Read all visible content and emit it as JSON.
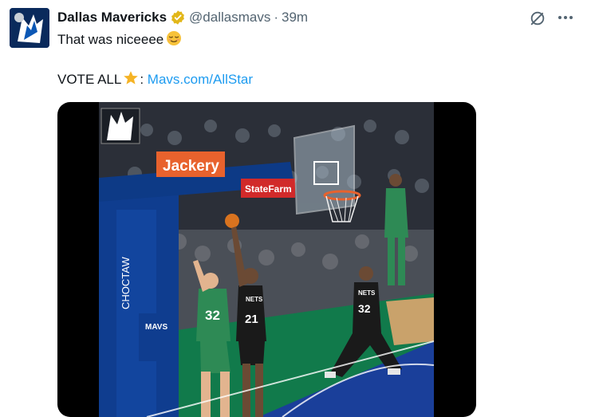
{
  "tweet": {
    "author_name": "Dallas Mavericks",
    "handle": "@dallasmavs",
    "separator": "·",
    "time": "39m",
    "text_line1": "That was niceeee",
    "text_line2_prefix": "VOTE ALL",
    "text_line2_colon": ":",
    "link_text": "Mavs.com/AllStar"
  },
  "video": {
    "sponsor_sign_1": "Jackery",
    "sponsor_sign_2": "StateFarm",
    "arena_sign": "CHOCTAW",
    "stanchion_text": "MAVS",
    "player_1_number": "32",
    "player_2_number": "21",
    "player_3_number": "32",
    "jersey_team": "NETS"
  },
  "colors": {
    "accent": "#1d9bf0",
    "verified": "#e2b719",
    "text_primary": "#0f1419",
    "text_secondary": "#536471"
  },
  "icons": {
    "verified": "verified-badge-icon",
    "grok": "grok-icon",
    "more": "more-horizontal-icon",
    "emoji1": "relieved-face-emoji",
    "emoji2": "star-emoji"
  }
}
